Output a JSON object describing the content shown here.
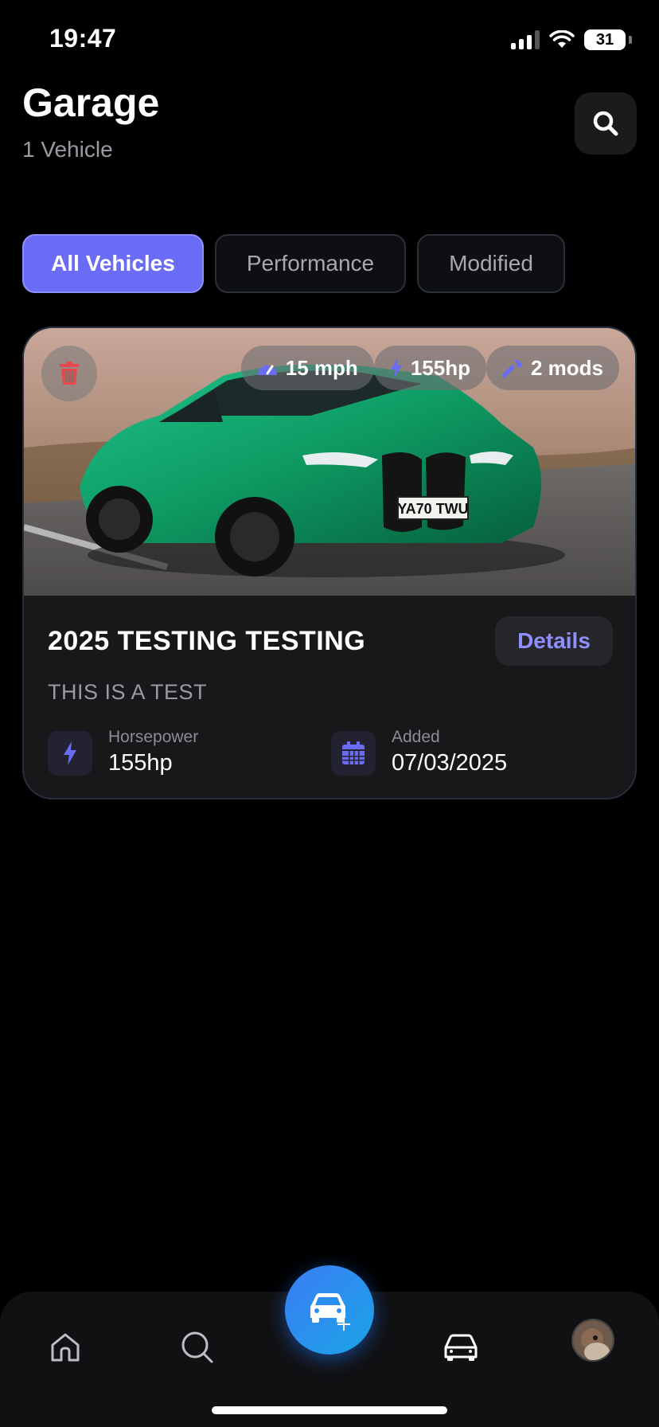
{
  "status_bar": {
    "time": "19:47",
    "battery": "31"
  },
  "header": {
    "title": "Garage",
    "subtitle": "1 Vehicle"
  },
  "tabs": [
    {
      "label": "All Vehicles",
      "active": true
    },
    {
      "label": "Performance",
      "active": false
    },
    {
      "label": "Modified",
      "active": false
    }
  ],
  "vehicle": {
    "badges": {
      "speed": "15 mph",
      "power": "155hp",
      "mods": "2 mods"
    },
    "plate": "YA70 TWU",
    "name": "2025 TESTING TESTING",
    "description": "THIS IS A TEST",
    "details_label": "Details",
    "stats": {
      "horsepower_label": "Horsepower",
      "horsepower_value": "155hp",
      "added_label": "Added",
      "added_value": "07/03/2025"
    }
  },
  "colors": {
    "accent": "#6b6cf6",
    "fab_start": "#3b7df5",
    "fab_end": "#1aa4e6",
    "danger": "#e5484d",
    "car_body": "#12a06a"
  },
  "icons": {
    "search": "search-icon",
    "trash": "trash-icon",
    "speed": "speedometer-icon",
    "power": "bolt-icon",
    "mods": "wrench-icon",
    "calendar": "calendar-icon",
    "home": "home-icon",
    "nav_search": "search-icon",
    "fab": "add-car-icon",
    "garage": "car-icon"
  }
}
